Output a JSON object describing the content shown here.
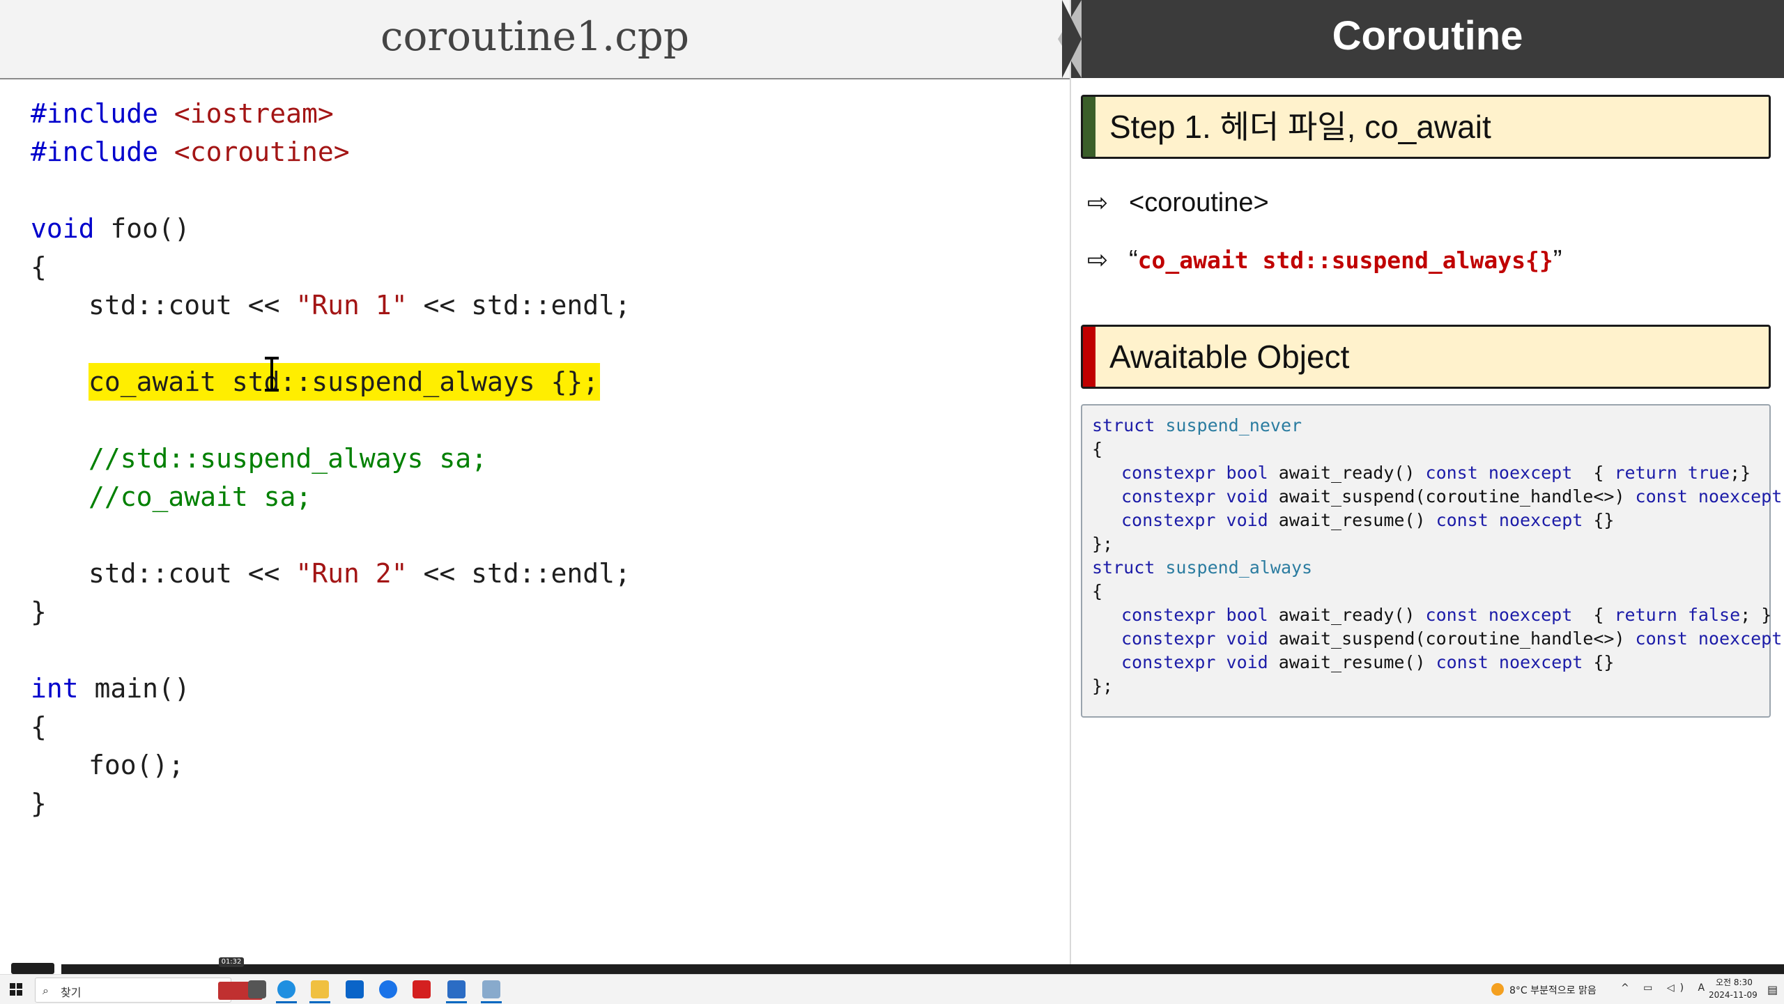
{
  "editor": {
    "file_title": "coroutine1.cpp",
    "lines": {
      "l1_kw": "#include",
      "l1_inc": "<iostream>",
      "l2_kw": "#include",
      "l2_inc": "<coroutine>",
      "l4_kw": "void",
      "l4_rest": " foo()",
      "l5": "{",
      "l6_a": "std::cout << ",
      "l6_str": "\"Run 1\"",
      "l6_b": " << std::endl;",
      "l8": "co_await std::suspend_always {};",
      "l10": "//std::suspend_always sa;",
      "l11": "//co_await sa;",
      "l13_a": "std::cout << ",
      "l13_str": "\"Run 2\"",
      "l13_b": " << std::endl;",
      "l14": "}",
      "l16_kw": "int",
      "l16_rest": " main()",
      "l17": "{",
      "l18": "foo();",
      "l19": "}"
    }
  },
  "slide": {
    "title": "Coroutine",
    "step_banner": "Step 1. 헤더 파일, co_await",
    "bullet_arrow": "⇨",
    "bullet1": "<coroutine>",
    "bullet2_open": "“",
    "bullet2_code": "co_await std::suspend_always{}",
    "bullet2_close": "”",
    "section_banner": "Awaitable Object",
    "code": {
      "b1_kw": "struct",
      "b1_t": "suspend_never",
      "b2": "{",
      "b3_k1": "constexpr",
      "b3_k2": "bool",
      "b3_f": " await_ready() ",
      "b3_k3": "const",
      "b3_k4": "noexcept",
      "b3_r1": "  { ",
      "b3_k5": "return",
      "b3_k6": "true",
      "b3_r2": ";}",
      "b4_k1": "constexpr",
      "b4_k2": "void",
      "b4_f": " await_suspend(coroutine_handle<>) ",
      "b4_k3": "const",
      "b4_k4": "noexcept",
      "b4_r": " {}",
      "b5_k1": "constexpr",
      "b5_k2": "void",
      "b5_f": " await_resume() ",
      "b5_k3": "const",
      "b5_k4": "noexcept",
      "b5_r": " {}",
      "b6": "};",
      "b7_kw": "struct",
      "b7_t": "suspend_always",
      "b8": "{",
      "b9_k1": "constexpr",
      "b9_k2": "bool",
      "b9_f": " await_ready() ",
      "b9_k3": "const",
      "b9_k4": "noexcept",
      "b9_r1": "  { ",
      "b9_k5": "return",
      "b9_k6": "false",
      "b9_r2": "; }",
      "b10_k1": "constexpr",
      "b10_k2": "void",
      "b10_f": " await_suspend(coroutine_handle<>) ",
      "b10_k3": "const",
      "b10_k4": "noexcept",
      "b10_r": " {}",
      "b11_k1": "constexpr",
      "b11_k2": "void",
      "b11_f": " await_resume() ",
      "b11_k3": "const",
      "b11_k4": "noexcept",
      "b11_r": " {}",
      "b12": "};"
    }
  },
  "player": {
    "time_tooltip": "01:32"
  },
  "taskbar": {
    "search_placeholder": "찾기",
    "search_icon": "⌕",
    "weather": "8°C  부분적으로 맑음",
    "tray_icons": "^ ▭ ◁) A",
    "clock_time": "오전 8:30",
    "clock_date": "2024-11-09",
    "notify_icon": "▤"
  },
  "colors": {
    "keyword": "#0000cc",
    "string": "#a31515",
    "comment": "#008000",
    "highlight": "#ffee00",
    "slide_header": "#3b3b3b",
    "banner_fill": "#fff2cc",
    "step_bar": "#3b5f2a",
    "section_bar": "#c00000"
  }
}
